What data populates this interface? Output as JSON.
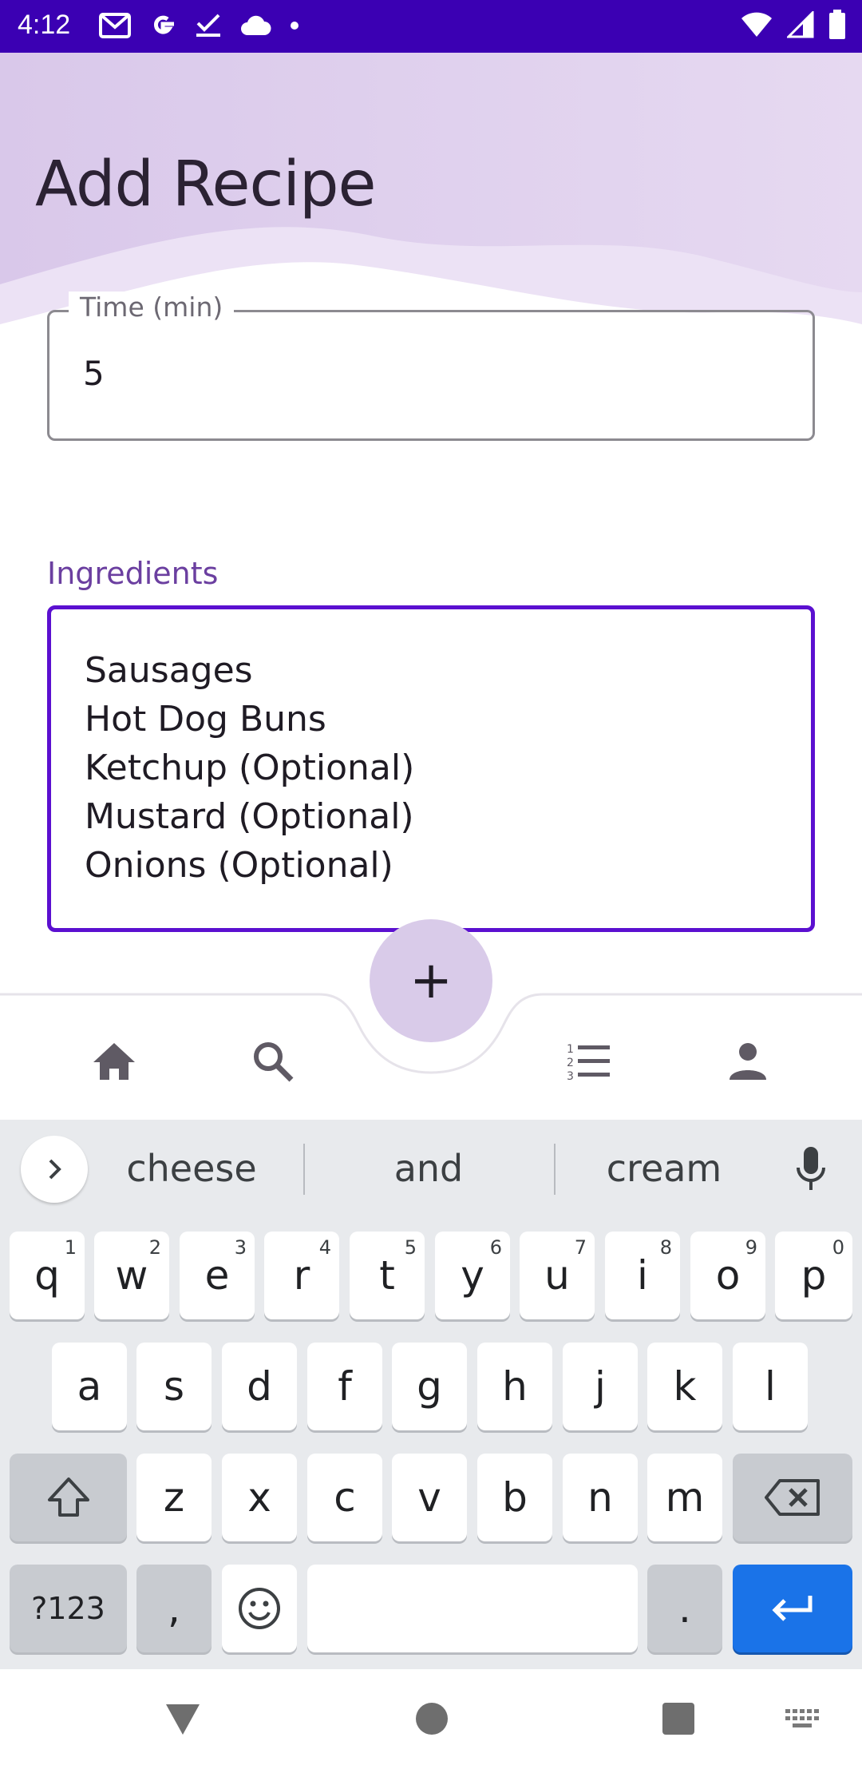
{
  "status_bar": {
    "time": "4:12",
    "left_icons": [
      "gmail-icon",
      "google-icon",
      "tasks-check-icon",
      "cloud-icon",
      "dot-icon"
    ],
    "right_icons": [
      "wifi-icon",
      "signal-icon",
      "battery-icon"
    ],
    "bar_color": "#3b00b3"
  },
  "header": {
    "title": "Add Recipe"
  },
  "time_field": {
    "label": "Time (min)",
    "value": "5"
  },
  "ingredients": {
    "label": "Ingredients",
    "items": [
      "Sausages",
      "Hot Dog Buns",
      "Ketchup (Optional)",
      "Mustard (Optional)",
      "Onions (Optional)"
    ],
    "focus_color": "#5b10d0"
  },
  "bottom_nav": {
    "items": [
      "home-icon",
      "search-icon",
      "list-numbered-icon",
      "person-icon"
    ],
    "fab_label": "+"
  },
  "keyboard": {
    "suggestions": [
      "cheese",
      "and",
      "cream"
    ],
    "row1": [
      [
        "q",
        "1"
      ],
      [
        "w",
        "2"
      ],
      [
        "e",
        "3"
      ],
      [
        "r",
        "4"
      ],
      [
        "t",
        "5"
      ],
      [
        "y",
        "6"
      ],
      [
        "u",
        "7"
      ],
      [
        "i",
        "8"
      ],
      [
        "o",
        "9"
      ],
      [
        "p",
        "0"
      ]
    ],
    "row2": [
      "a",
      "s",
      "d",
      "f",
      "g",
      "h",
      "j",
      "k",
      "l"
    ],
    "row3": [
      "z",
      "x",
      "c",
      "v",
      "b",
      "n",
      "m"
    ],
    "symbols_key": "?123",
    "comma_key": ",",
    "period_key": ".",
    "enter_color": "#1a73e8"
  },
  "system_nav": {
    "items": [
      "back-icon",
      "home-circle-icon",
      "recents-icon",
      "keyboard-switch-icon"
    ]
  }
}
